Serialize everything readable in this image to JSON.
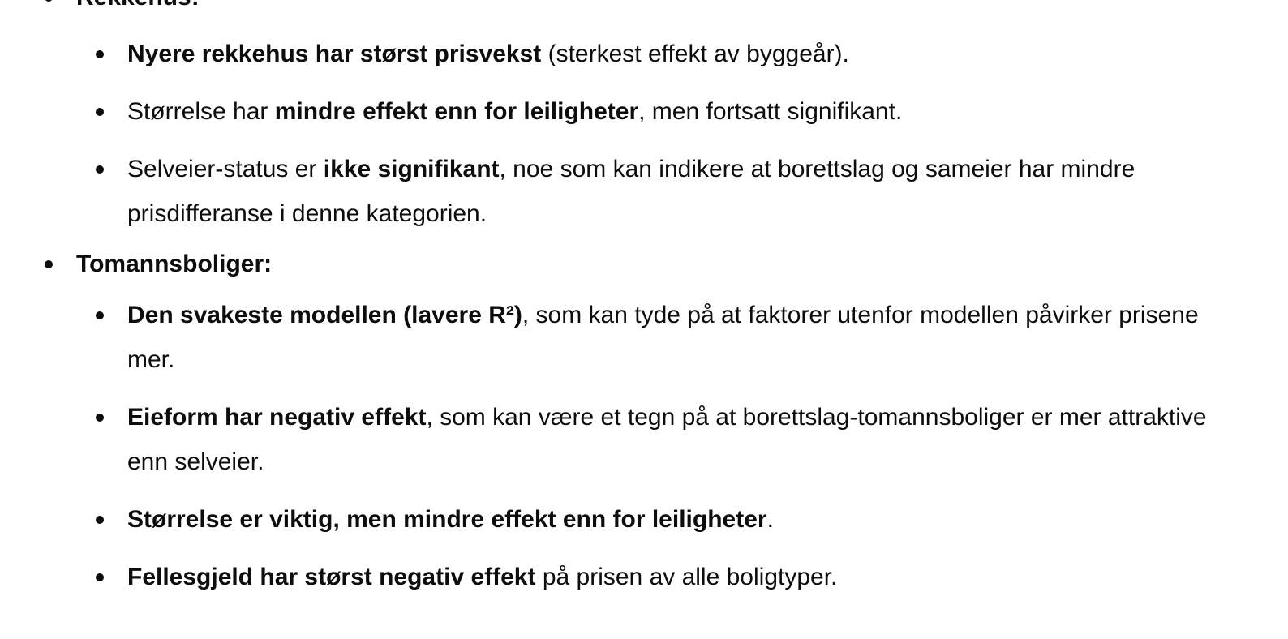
{
  "sections": [
    {
      "heading": "Rekkehus:",
      "items": [
        {
          "b1": "Nyere rekkehus har størst prisvekst",
          "t1": " (sterkest effekt av byggeår)."
        },
        {
          "t0": "Størrelse har ",
          "b1": "mindre effekt enn for leiligheter",
          "t1": ", men fortsatt signifikant."
        },
        {
          "t0": "Selveier-status er ",
          "b1": "ikke signifikant",
          "t1": ", noe som kan indikere at borettslag og sameier har mindre prisdifferanse i denne kategorien."
        }
      ]
    },
    {
      "heading": "Tomannsboliger:",
      "items": [
        {
          "b1": "Den svakeste modellen (lavere R²)",
          "t1": ", som kan tyde på at faktorer utenfor modellen påvirker prisene mer."
        },
        {
          "b1": "Eieform har negativ effekt",
          "t1": ", som kan være et tegn på at borettslag-tomannsboliger er mer attraktive enn selveier."
        },
        {
          "b1": "Størrelse er viktig, men mindre effekt enn for leiligheter",
          "t1": "."
        },
        {
          "b1": "Fellesgjeld har størst negativ effekt",
          "t1": " på prisen av alle boligtyper."
        }
      ]
    }
  ]
}
